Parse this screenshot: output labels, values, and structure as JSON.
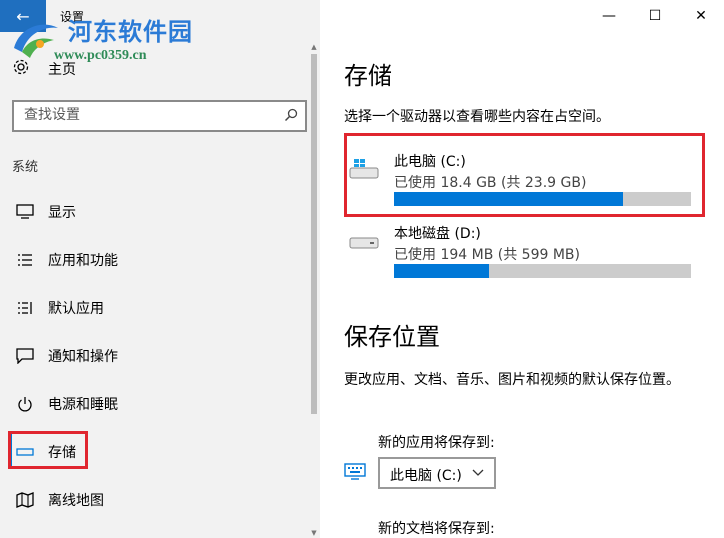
{
  "window": {
    "title": "设置",
    "minimize": "—",
    "maximize": "☐",
    "close": "✕",
    "back": "←"
  },
  "watermark": {
    "title": "河东软件园",
    "url": "www.pc0359.cn"
  },
  "sidebar": {
    "home": "主页",
    "search_placeholder": "查找设置",
    "section": "系统",
    "items": [
      {
        "label": "显示",
        "icon": "display-icon"
      },
      {
        "label": "应用和功能",
        "icon": "apps-list-icon"
      },
      {
        "label": "默认应用",
        "icon": "default-apps-icon"
      },
      {
        "label": "通知和操作",
        "icon": "notification-icon"
      },
      {
        "label": "电源和睡眠",
        "icon": "power-icon"
      },
      {
        "label": "存储",
        "icon": "storage-icon",
        "active": true
      },
      {
        "label": "离线地图",
        "icon": "map-icon"
      }
    ]
  },
  "main": {
    "title": "存储",
    "description": "选择一个驱动器以查看哪些内容在占空间。",
    "drives": [
      {
        "name": "此电脑 (C:)",
        "usage": "已使用 18.4 GB (共 23.9 GB)",
        "used_fraction": 0.77
      },
      {
        "name": "本地磁盘 (D:)",
        "usage": "已使用 194 MB (共 599 MB)",
        "used_fraction": 0.32
      }
    ],
    "save_locations": {
      "title": "保存位置",
      "description": "更改应用、文档、音乐、图片和视频的默认保存位置。",
      "apps_label": "新的应用将保存到:",
      "apps_value": "此电脑 (C:)",
      "docs_label": "新的文档将保存到:"
    }
  },
  "colors": {
    "accent": "#0078d7",
    "highlight": "#e0262f",
    "sidebar_bg": "#f2f2f2",
    "back_button": "#1f6fbf"
  }
}
